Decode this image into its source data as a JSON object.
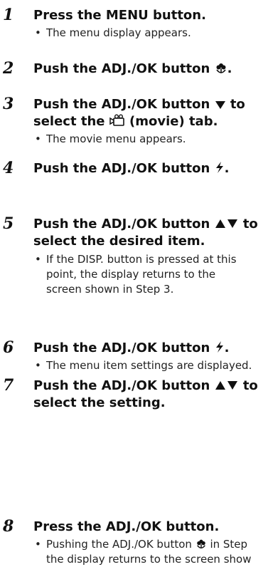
{
  "steps": [
    {
      "num": "1",
      "title_parts": [
        "Press the MENU button."
      ],
      "sub": "The menu display appears."
    },
    {
      "num": "2",
      "title_parts": [
        "Push the ADJ./OK button ",
        "."
      ]
    },
    {
      "num": "3",
      "title_parts": [
        "Push the ADJ./OK button ",
        " to\nselect the ",
        " (movie) tab."
      ],
      "sub": "The movie menu appears."
    },
    {
      "num": "4",
      "title_parts": [
        "Push the ADJ./OK button ",
        "."
      ]
    },
    {
      "num": "5",
      "title_parts": [
        "Push the ADJ./OK button ",
        " to\nselect the desired item."
      ],
      "sub": "If the DISP. button is pressed at this\npoint, the display returns to the\nscreen shown in Step 3."
    },
    {
      "num": "6",
      "title_parts": [
        "Push the ADJ./OK button ",
        "."
      ],
      "sub": "The menu item settings are displayed."
    },
    {
      "num": "7",
      "title_parts": [
        "Push the ADJ./OK button ",
        " to\nselect the setting."
      ]
    },
    {
      "num": "8",
      "title_parts": [
        "Press the ADJ./OK button."
      ],
      "sub_parts": [
        "Pushing the ADJ./OK button ",
        " in Step\nthe display returns to the screen show"
      ]
    }
  ],
  "bullet": "•",
  "icons": {
    "macro": "macro-flower-icon",
    "down": "down-triangle-icon",
    "movie": "movie-camera-icon",
    "flash": "flash-icon",
    "updown": "up-down-triangles-icon"
  }
}
